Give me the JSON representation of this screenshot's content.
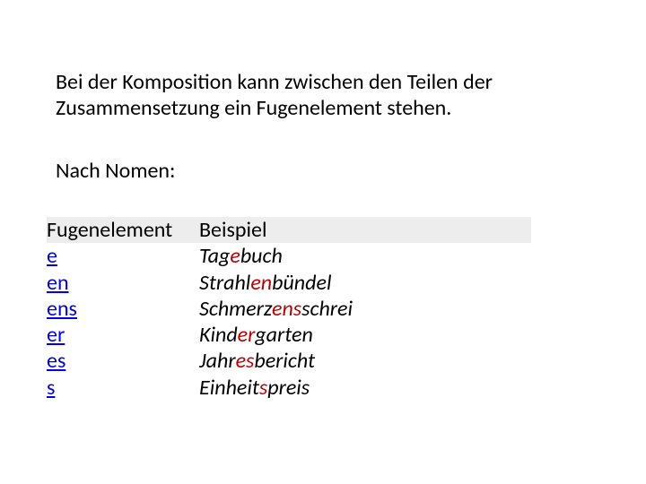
{
  "intro": "Bei der Komposition kann zwischen den Teilen der Zusammensetzung ein Fugenelement stehen.",
  "subhead": "Nach Nomen:",
  "headers": {
    "left": "Fugenelement",
    "right": "Beispiel"
  },
  "rows": [
    {
      "fuge": "e",
      "pre": "Tag",
      "mid": "e",
      "post": "buch"
    },
    {
      "fuge": "en",
      "pre": "Strahl",
      "mid": "en",
      "post": "bündel"
    },
    {
      "fuge": "ens",
      "pre": "Schmerz",
      "mid": "ens",
      "post": "schrei"
    },
    {
      "fuge": "er",
      "pre": "Kind",
      "mid": "er",
      "post": "garten"
    },
    {
      "fuge": "es",
      "pre": "Jahr",
      "mid": "es",
      "post": "bericht"
    },
    {
      "fuge": "s",
      "pre": "Einheit",
      "mid": "s",
      "post": "preis"
    }
  ]
}
